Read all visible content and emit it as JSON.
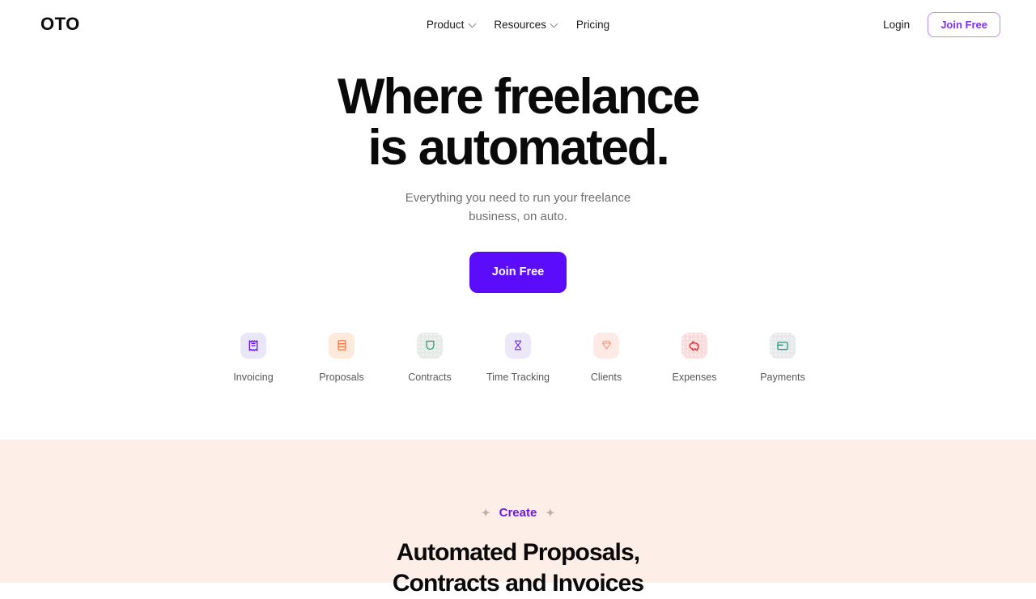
{
  "header": {
    "logo": "OTO",
    "nav": [
      {
        "label": "Product",
        "has_chevron": true,
        "icon": "chevron-down-icon"
      },
      {
        "label": "Resources",
        "has_chevron": true,
        "icon": "chevron-down-icon"
      },
      {
        "label": "Pricing",
        "has_chevron": false,
        "icon": ""
      }
    ],
    "login_label": "Login",
    "join_label": "Join Free"
  },
  "hero": {
    "heading_line1": "Where freelance",
    "heading_line2": "is automated.",
    "sub_line1": "Everything you need to run your freelance",
    "sub_line2": "business, on auto.",
    "cta_label": "Join Free"
  },
  "features": [
    {
      "label": "Invoicing",
      "icon": "receipt-icon",
      "tile_bg": "#e9e6f7",
      "icon_color": "#5a0cfb",
      "dots": false
    },
    {
      "label": "Proposals",
      "icon": "document-icon",
      "tile_bg": "#fdeadd",
      "icon_color": "#f4733f",
      "dots": false
    },
    {
      "label": "Contracts",
      "icon": "shield-icon",
      "tile_bg": "#e7ebe8",
      "icon_color": "#1f9e7a",
      "dots": true
    },
    {
      "label": "Time Tracking",
      "icon": "hourglass-icon",
      "tile_bg": "#ece8f8",
      "icon_color": "#7b2ff7",
      "dots": false
    },
    {
      "label": "Clients",
      "icon": "heart-icon",
      "tile_bg": "#fdeae4",
      "icon_color": "#f6a08c",
      "dots": false
    },
    {
      "label": "Expenses",
      "icon": "piggy-bank-icon",
      "tile_bg": "#fbdcdd",
      "icon_color": "#ef2b2b",
      "dots": true
    },
    {
      "label": "Payments",
      "icon": "wallet-icon",
      "tile_bg": "#e8e9ea",
      "icon_color": "#1f9e7a",
      "dots": true
    }
  ],
  "create_section": {
    "eyebrow": "Create",
    "spark_left": "✦",
    "spark_right": "✦",
    "heading_line1": "Automated Proposals,",
    "heading_line2": "Contracts and Invoices",
    "background": "#fdeee7",
    "accent": "#6a16f5"
  },
  "colors": {
    "brand_purple": "#5a0cfb",
    "accent_purple": "#7b2ff7",
    "cream": "#fdeee7",
    "text_dark": "#0a0a0a",
    "text_muted": "#6f6f6f"
  }
}
